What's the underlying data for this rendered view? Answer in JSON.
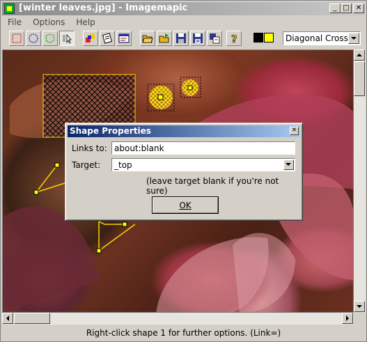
{
  "window": {
    "title": "[winter leaves.jpg] - Imagemapic"
  },
  "menu": [
    "File",
    "Options",
    "Help"
  ],
  "toolbar": {
    "pattern_select": "Diagonal Cross",
    "colors": {
      "primary": "#000000",
      "secondary": "#ffff00"
    },
    "icons": [
      "rectangle-tool-icon",
      "circle-tool-icon",
      "polygon-tool-icon",
      "pointer-tool-icon",
      "shapes-icon",
      "properties-icon",
      "html-icon",
      "open-icon",
      "open-folder-icon",
      "save-icon",
      "save-as-icon",
      "export-icon",
      "help-icon"
    ]
  },
  "dialog": {
    "title": "Shape Properties",
    "links_label": "Links to:",
    "links_value": "about:blank",
    "target_label": "Target:",
    "target_value": "_top",
    "hint": "(leave target blank if you're not sure)",
    "ok_label": "OK"
  },
  "status": "Right-click shape 1 for further options. (Link=)"
}
